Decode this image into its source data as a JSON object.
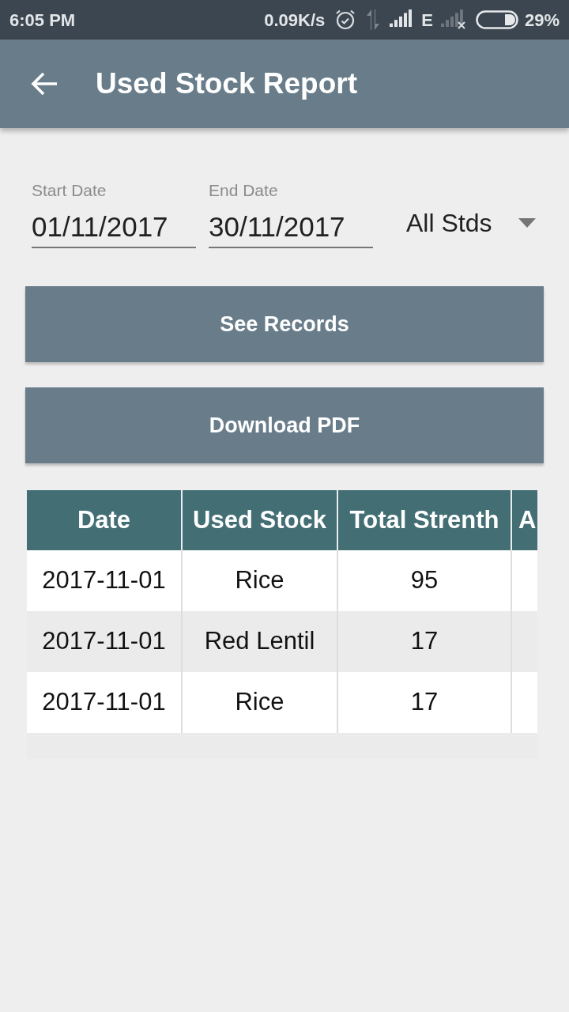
{
  "status_bar": {
    "time": "6:05 PM",
    "network_speed": "0.09K/s",
    "network_type": "E",
    "battery": "29%"
  },
  "app_bar": {
    "title": "Used Stock Report"
  },
  "filters": {
    "start_date": {
      "label": "Start Date",
      "value": "01/11/2017"
    },
    "end_date": {
      "label": "End Date",
      "value": "30/11/2017"
    },
    "standard_select": {
      "value": "All Stds"
    }
  },
  "buttons": [
    {
      "label": "See Records"
    },
    {
      "label": "Download PDF"
    }
  ],
  "table": {
    "columns": [
      "Date",
      "Used Stock",
      "Total Strenth",
      "A"
    ],
    "rows": [
      {
        "cells": [
          "2017-11-01",
          "Rice",
          "95"
        ]
      },
      {
        "cells": [
          "2017-11-01",
          "Red Lentil",
          "17"
        ]
      },
      {
        "cells": [
          "2017-11-01",
          "Rice",
          "17"
        ]
      }
    ]
  }
}
